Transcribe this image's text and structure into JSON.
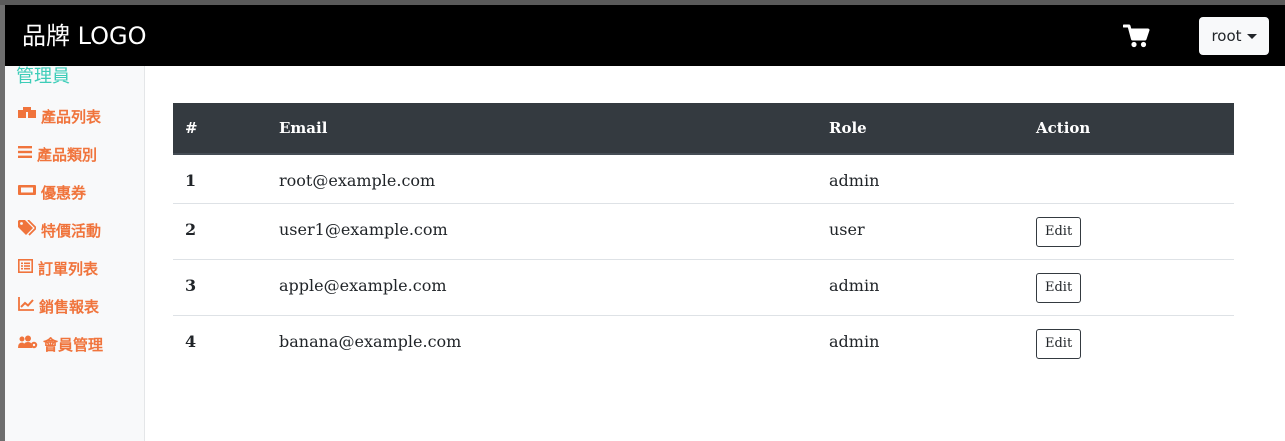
{
  "navbar": {
    "brand": "品牌 LOGO",
    "cart_icon": "shopping-cart-icon",
    "user_menu_label": "root"
  },
  "sidebar": {
    "title": "管理員",
    "items": [
      {
        "label": "產品列表",
        "icon": "boxes-icon"
      },
      {
        "label": "產品類別",
        "icon": "list-icon"
      },
      {
        "label": "優惠券",
        "icon": "ticket-icon"
      },
      {
        "label": "特價活動",
        "icon": "tags-icon"
      },
      {
        "label": "訂單列表",
        "icon": "list-alt-icon"
      },
      {
        "label": "銷售報表",
        "icon": "chart-line-icon"
      },
      {
        "label": "會員管理",
        "icon": "users-cog-icon"
      }
    ]
  },
  "table": {
    "headers": [
      "#",
      "Email",
      "Role",
      "Action"
    ],
    "rows": [
      {
        "num": "1",
        "email": "root@example.com",
        "role": "admin",
        "action": ""
      },
      {
        "num": "2",
        "email": "user1@example.com",
        "role": "user",
        "action": "Edit"
      },
      {
        "num": "3",
        "email": "apple@example.com",
        "role": "admin",
        "action": "Edit"
      },
      {
        "num": "4",
        "email": "banana@example.com",
        "role": "admin",
        "action": "Edit"
      }
    ]
  },
  "colors": {
    "navbar_bg": "#000000",
    "sidebar_accent": "#f0743c",
    "sidebar_title": "#3dcdb8",
    "table_head_bg": "#343a40"
  }
}
